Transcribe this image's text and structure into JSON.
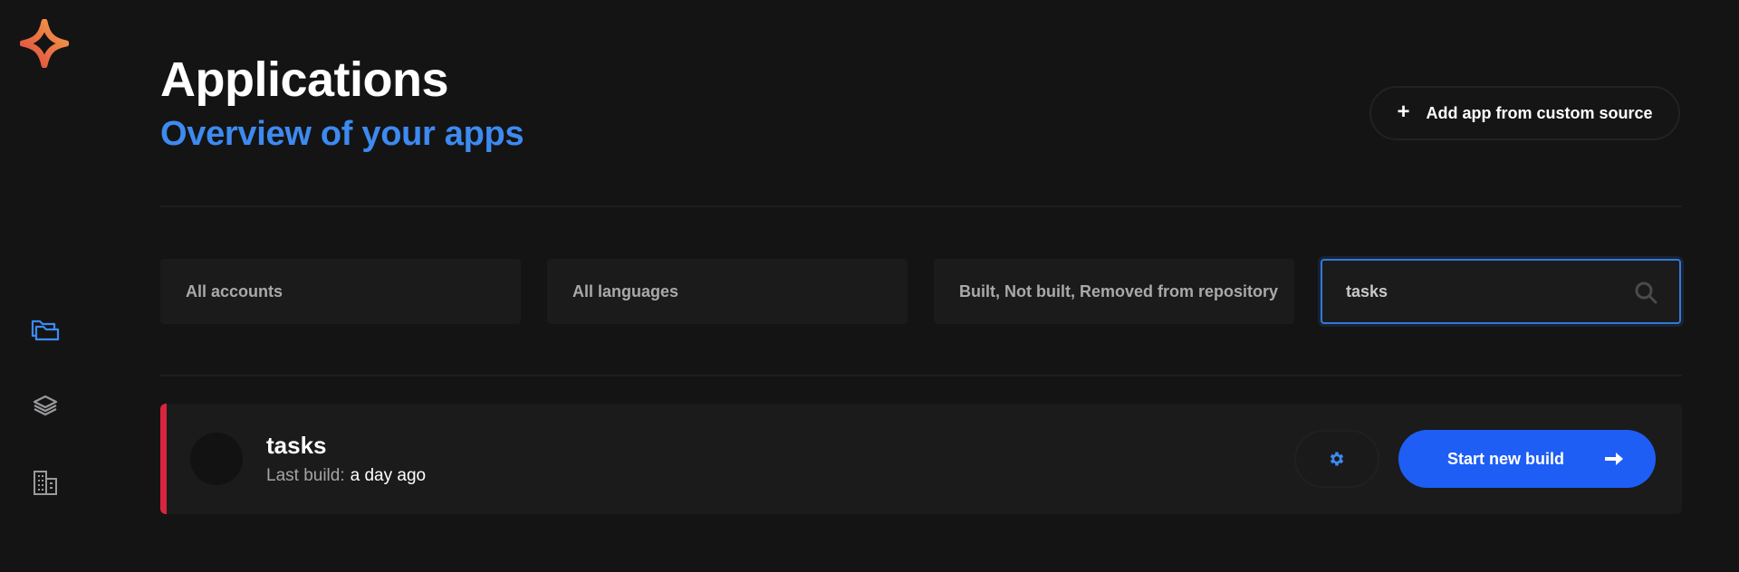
{
  "header": {
    "title": "Applications",
    "subtitle": "Overview of your apps",
    "add_button_label": "Add app from custom source",
    "add_button_icon": "plus-icon"
  },
  "sidebar": {
    "logo": "star-logo",
    "items": [
      {
        "name": "applications",
        "icon": "folders-icon",
        "active": true
      },
      {
        "name": "layers",
        "icon": "layers-icon",
        "active": false
      },
      {
        "name": "organization",
        "icon": "building-icon",
        "active": false
      }
    ]
  },
  "filters": {
    "accounts": "All accounts",
    "languages": "All languages",
    "status": "Built, Not built, Removed from repository",
    "search_value": "tasks",
    "search_icon": "search-icon"
  },
  "apps": [
    {
      "name": "tasks",
      "last_build_label": "Last build:",
      "last_build_value": "a day ago",
      "status_color": "#d7263d",
      "settings_icon": "gear-icon",
      "build_button_label": "Start new build",
      "build_button_icon": "arrow-right-icon"
    }
  ],
  "colors": {
    "background": "#141415",
    "accent": "#3d8af0",
    "primary_button": "#1f5ef5",
    "error": "#d7263d"
  }
}
